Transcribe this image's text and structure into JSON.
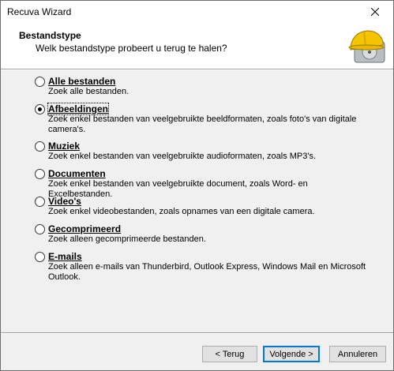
{
  "window": {
    "title": "Recuva Wizard"
  },
  "header": {
    "title": "Bestandstype",
    "subtitle": "Welk bestandstype probeert u terug te halen?"
  },
  "options": [
    {
      "label": "Alle bestanden",
      "description": "Zoek alle bestanden.",
      "selected": false
    },
    {
      "label": "Afbeeldingen",
      "description": "Zoek enkel bestanden van veelgebruikte beeldformaten, zoals foto's van digitale camera's.",
      "selected": true
    },
    {
      "label": "Muziek",
      "description": "Zoek enkel bestanden van veelgebruikte audioformaten, zoals MP3's.",
      "selected": false
    },
    {
      "label": "Documenten",
      "description": "Zoek enkel bestanden van veelgebruikte document, zoals Word- en Excelbestanden.",
      "selected": false
    },
    {
      "label": "Video's",
      "description": "Zoek enkel videobestanden, zoals opnames van een digitale camera.",
      "selected": false
    },
    {
      "label": "Gecomprimeerd",
      "description": "Zoek alleen gecomprimeerde bestanden.",
      "selected": false
    },
    {
      "label": "E-mails",
      "description": "Zoek alleen e-mails van Thunderbird, Outlook Express, Windows Mail en Microsoft Outlook.",
      "selected": false
    }
  ],
  "buttons": {
    "back": "< Terug",
    "next": "Volgende >",
    "cancel": "Annuleren"
  },
  "colors": {
    "accent": "#0078d7",
    "logo_helmet": "#f5c400",
    "logo_drive": "#c0c4c8"
  }
}
